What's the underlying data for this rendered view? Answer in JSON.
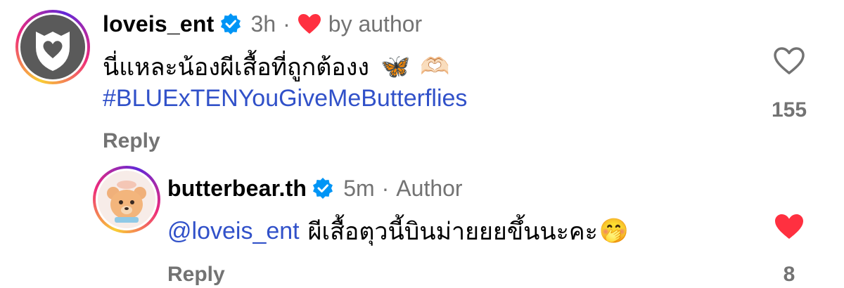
{
  "comments": [
    {
      "username": "loveis_ent",
      "time": "3h",
      "separator": "·",
      "liked_by_author_label": "by author",
      "text": "นี่แหละน้องผีเสื้อที่ถูกต้องง",
      "emojis": [
        "🦋",
        "🫶🏻"
      ],
      "hashtag": "#BLUExTENYouGiveMeButterflies",
      "reply_label": "Reply",
      "like_count": "155",
      "liked": false,
      "avatar_icon": "heart-shield-logo"
    },
    {
      "username": "butterbear.th",
      "time": "5m",
      "separator": "·",
      "author_label": "Author",
      "mention": "@loveis_ent",
      "text": "ผีเสื้อตุวนี้บินม่ายยยขึ้นนะคะ",
      "emoji": "🤭",
      "reply_label": "Reply",
      "like_count": "8",
      "liked": true,
      "avatar_icon": "bear-avatar"
    }
  ],
  "colors": {
    "verified": "#0095f6",
    "heart_red": "#ff3040",
    "link_blue": "#3151c9",
    "meta_gray": "#737373"
  }
}
